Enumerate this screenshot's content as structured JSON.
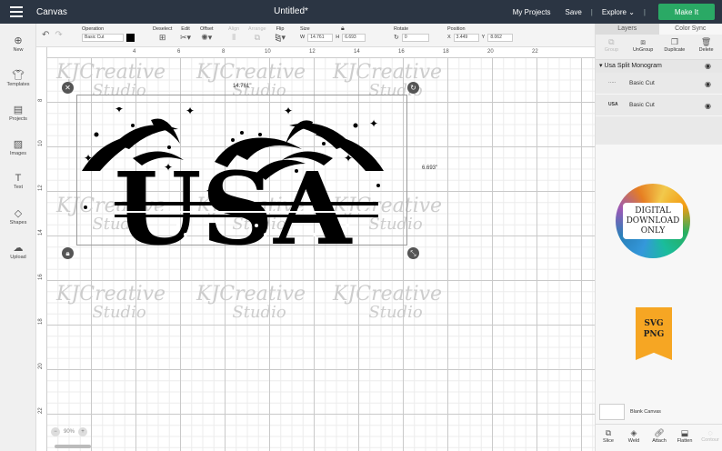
{
  "topbar": {
    "app_title": "Canvas",
    "doc_title": "Untitled*",
    "my_projects": "My Projects",
    "save": "Save",
    "explore": "Explore",
    "make_it": "Make It"
  },
  "toolbar": {
    "operation_label": "Operation",
    "operation_value": "Basic Cut",
    "deselect": "Deselect",
    "edit": "Edit",
    "offset": "Offset",
    "align": "Align",
    "arrange": "Arrange",
    "flip": "Flip",
    "size_label": "Size",
    "w_label": "W",
    "w_value": "14.761",
    "h_label": "H",
    "h_value": "6.693",
    "rotate_label": "Rotate",
    "rotate_value": "0",
    "position_label": "Position",
    "x_label": "X",
    "x_value": "3.449",
    "y_label": "Y",
    "y_value": "8.062",
    "color": "#000000"
  },
  "sidebar": {
    "items": [
      {
        "label": "New",
        "icon": "plus-icon"
      },
      {
        "label": "Templates",
        "icon": "shirt-icon"
      },
      {
        "label": "Projects",
        "icon": "projects-icon"
      },
      {
        "label": "Images",
        "icon": "image-icon"
      },
      {
        "label": "Text",
        "icon": "text-icon"
      },
      {
        "label": "Shapes",
        "icon": "shapes-icon"
      },
      {
        "label": "Upload",
        "icon": "upload-icon"
      }
    ]
  },
  "canvas": {
    "ruler_top": [
      "4",
      "6",
      "8",
      "10",
      "12",
      "14",
      "16",
      "18",
      "20",
      "22"
    ],
    "ruler_left": [
      "8",
      "10",
      "12",
      "14",
      "16",
      "18",
      "20",
      "22"
    ],
    "dim_width": "14.761\"",
    "dim_height": "6.693\"",
    "design_text": "USA",
    "watermark_line1": "KJCreative",
    "watermark_line2": "Studio",
    "zoom_value": "90%",
    "zoom_minus": "−",
    "zoom_plus": "+"
  },
  "right_panel": {
    "tabs": [
      "Layers",
      "Color Sync"
    ],
    "tools": [
      "Group",
      "UnGroup",
      "Duplicate",
      "Delete"
    ],
    "group_name": "Usa Split Monogram",
    "layers": [
      {
        "name": "Basic Cut",
        "thumb": "·····"
      },
      {
        "name": "Basic Cut",
        "thumb": "USA"
      }
    ],
    "promo_line1": "DIGITAL",
    "promo_line2": "DOWNLOAD",
    "promo_line3": "ONLY",
    "banner_line1": "SVG",
    "banner_line2": "PNG",
    "blank_canvas": "Blank Canvas",
    "bottom_tools": [
      "Slice",
      "Weld",
      "Attach",
      "Flatten",
      "Contour"
    ]
  }
}
